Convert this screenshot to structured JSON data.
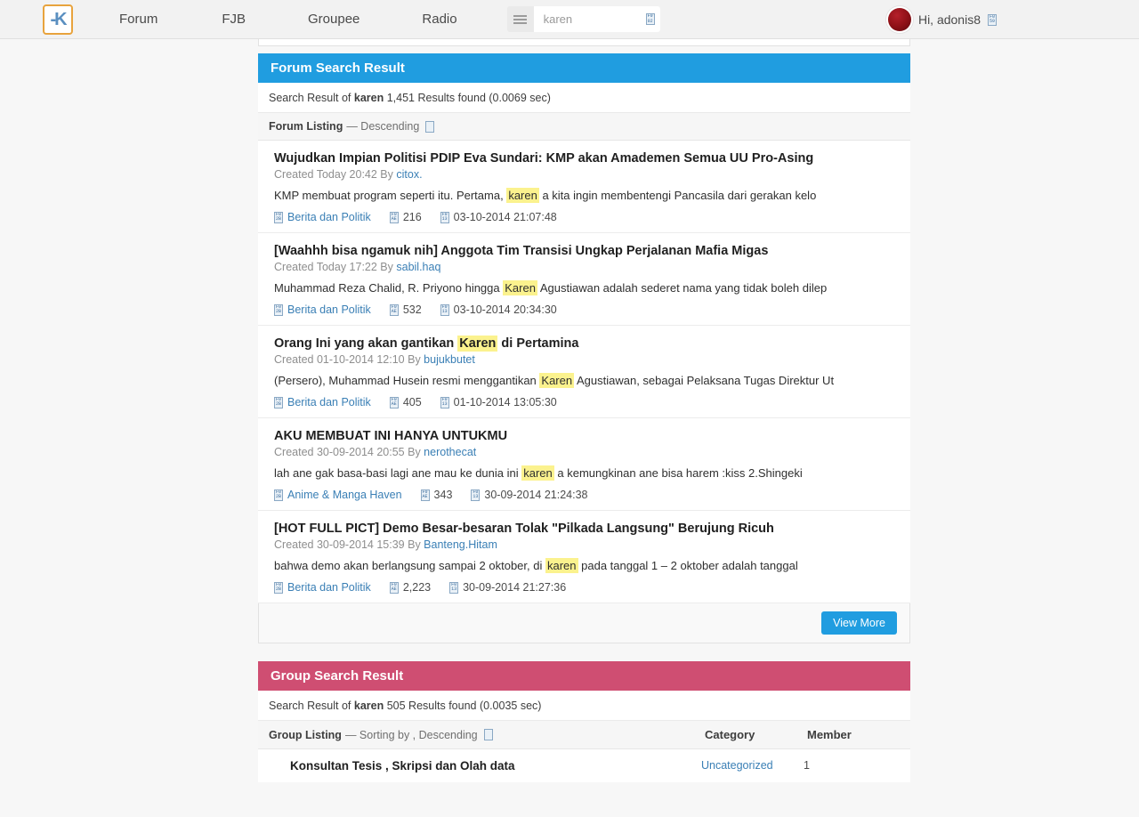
{
  "header": {
    "logo_label": "K",
    "nav": [
      {
        "label": "Forum"
      },
      {
        "label": "FJB"
      },
      {
        "label": "Groupee"
      },
      {
        "label": "Radio"
      }
    ],
    "search": {
      "value": "karen",
      "placeholder": "karen",
      "menu_icon": "hamburger-icon",
      "search_icon": "F0 02"
    },
    "user": {
      "greeting": "Hi, adonis8",
      "badge_icon": "F0 59",
      "avatar_icon": "avatar"
    }
  },
  "forum_section": {
    "banner_title": "Forum Search Result",
    "banner_color": "#209de0",
    "summary_prefix": "Search Result of ",
    "summary_query": "karen",
    "summary_suffix": " 1,451 Results found (0.0069 sec)",
    "listing_title": "Forum Listing",
    "listing_sort": "— Descending",
    "listing_icon": "sort-toggle-icon",
    "view_more_label": "View More",
    "results": [
      {
        "title": "Wujudkan Impian Politisi PDIP Eva Sundari: KMP akan Amademen Semua UU Pro-Asing",
        "meta_prefix": "Created Today 20:42 By ",
        "author": "citox.",
        "snippet_before": "KMP membuat program seperti itu. Pertama, ",
        "snippet_highlight": "karen",
        "snippet_after": " a kita ingin membentengi Pancasila dari gerakan kelo",
        "category": "Berita dan Politik",
        "views": "216",
        "date": "03-10-2014 21:07:48",
        "category_icon": "F0 2B",
        "views_icon": "F0 AE",
        "date_icon": "F0 13"
      },
      {
        "title": "[Waahhh bisa ngamuk nih] Anggota Tim Transisi Ungkap Perjalanan Mafia Migas",
        "meta_prefix": "Created Today 17:22 By ",
        "author": "sabil.haq",
        "snippet_before": "Muhammad Reza Chalid, R. Priyono hingga ",
        "snippet_highlight": "Karen",
        "snippet_after": " Agustiawan adalah sederet nama yang tidak boleh dilep",
        "category": "Berita dan Politik",
        "views": "532",
        "date": "03-10-2014 20:34:30",
        "category_icon": "F0 2B",
        "views_icon": "F0 AE",
        "date_icon": "F0 13"
      },
      {
        "title_before": "Orang Ini yang akan gantikan ",
        "title_highlight": "Karen",
        "title_after": " di Pertamina",
        "title": "Orang Ini yang akan gantikan Karen di Pertamina",
        "meta_prefix": "Created 01-10-2014 12:10 By ",
        "author": "bujukbutet",
        "snippet_before": "(Persero), Muhammad Husein resmi menggantikan ",
        "snippet_highlight": "Karen",
        "snippet_after": " Agustiawan, sebagai Pelaksana Tugas Direktur Ut",
        "category": "Berita dan Politik",
        "views": "405",
        "date": "01-10-2014 13:05:30",
        "category_icon": "F0 2B",
        "views_icon": "F0 AE",
        "date_icon": "F0 13"
      },
      {
        "title": "AKU MEMBUAT INI HANYA UNTUKMU",
        "meta_prefix": "Created 30-09-2014 20:55 By ",
        "author": "nerothecat",
        "snippet_before": "lah ane gak basa-basi lagi ane mau ke dunia ini ",
        "snippet_highlight": "karen",
        "snippet_after": " a kemungkinan ane bisa harem :kiss 2.Shingeki",
        "category": "Anime & Manga Haven",
        "views": "343",
        "date": "30-09-2014 21:24:38",
        "category_icon": "F0 2B",
        "views_icon": "F0 AE",
        "date_icon": "F0 13"
      },
      {
        "title": "[HOT FULL PICT] Demo Besar-besaran Tolak \"Pilkada Langsung\" Berujung Ricuh",
        "meta_prefix": "Created 30-09-2014 15:39 By ",
        "author": "Banteng.Hitam",
        "snippet_before": "bahwa demo akan berlangsung sampai 2 oktober, di ",
        "snippet_highlight": "karen",
        "snippet_after": " pada tanggal 1 – 2 oktober adalah tanggal",
        "category": "Berita dan Politik",
        "views": "2,223",
        "date": "30-09-2014 21:27:36",
        "category_icon": "F0 2B",
        "views_icon": "F0 AE",
        "date_icon": "F0 13"
      }
    ]
  },
  "group_section": {
    "banner_title": "Group Search Result",
    "banner_color": "#cf4e72",
    "summary_prefix": "Search Result of ",
    "summary_query": "karen",
    "summary_suffix": " 505 Results found (0.0035 sec)",
    "listing_title": "Group Listing",
    "listing_sort": "— Sorting by , Descending",
    "listing_icon": "sort-toggle-icon",
    "col_category": "Category",
    "col_member": "Member",
    "rows": [
      {
        "name": "Konsultan Tesis , Skripsi dan Olah data",
        "category": "Uncategorized",
        "member": "1"
      }
    ]
  }
}
